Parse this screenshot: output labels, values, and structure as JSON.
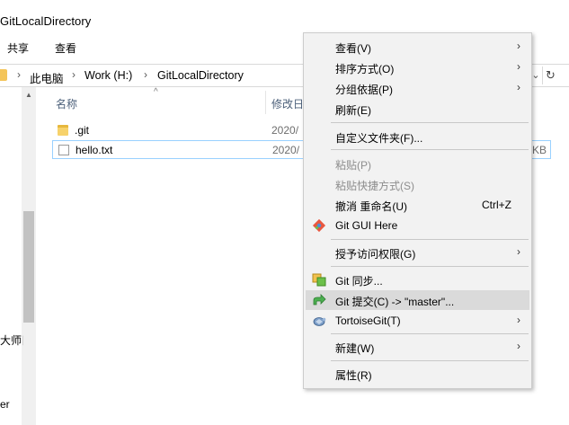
{
  "window": {
    "title": "GitLocalDirectory"
  },
  "ribbon": {
    "tabs": [
      "共享",
      "查看"
    ]
  },
  "address": {
    "crumbs": [
      "此电脑",
      "Work (H:)",
      "GitLocalDirectory"
    ],
    "separator": "›",
    "dropdown": "⌄",
    "refresh": "↻"
  },
  "navpane": {
    "texts": [
      "大师目",
      "er"
    ]
  },
  "filelist": {
    "columns": {
      "name": "名称",
      "modified": "修改日",
      "sort_caret": "^"
    },
    "rows": [
      {
        "name": ".git",
        "date": "2020/",
        "size": "",
        "icon": "folder-icon"
      },
      {
        "name": "hello.txt",
        "date": "2020/",
        "size": "KB",
        "icon": "text-file-icon"
      }
    ]
  },
  "context_menu": {
    "items": {
      "view": "查看(V)",
      "sort": "排序方式(O)",
      "group": "分组依据(P)",
      "refresh": "刷新(E)",
      "customize": "自定义文件夹(F)...",
      "paste": "粘贴(P)",
      "paste_shortcut": "粘贴快捷方式(S)",
      "undo_rename": "撤消 重命名(U)",
      "undo_shortcut": "Ctrl+Z",
      "git_gui": "Git GUI Here",
      "give_access": "授予访问权限(G)",
      "git_sync": "Git 同步...",
      "git_commit": "Git 提交(C) -> \"master\"...",
      "tortoisegit": "TortoiseGit(T)",
      "new": "新建(W)",
      "properties": "属性(R)"
    },
    "submenu_arrow": "›"
  },
  "colors": {
    "selection_border": "#99d1ff",
    "menu_background": "#f2f2f2",
    "menu_hover": "#dadada",
    "accent_blue": "#0e6fbf"
  }
}
